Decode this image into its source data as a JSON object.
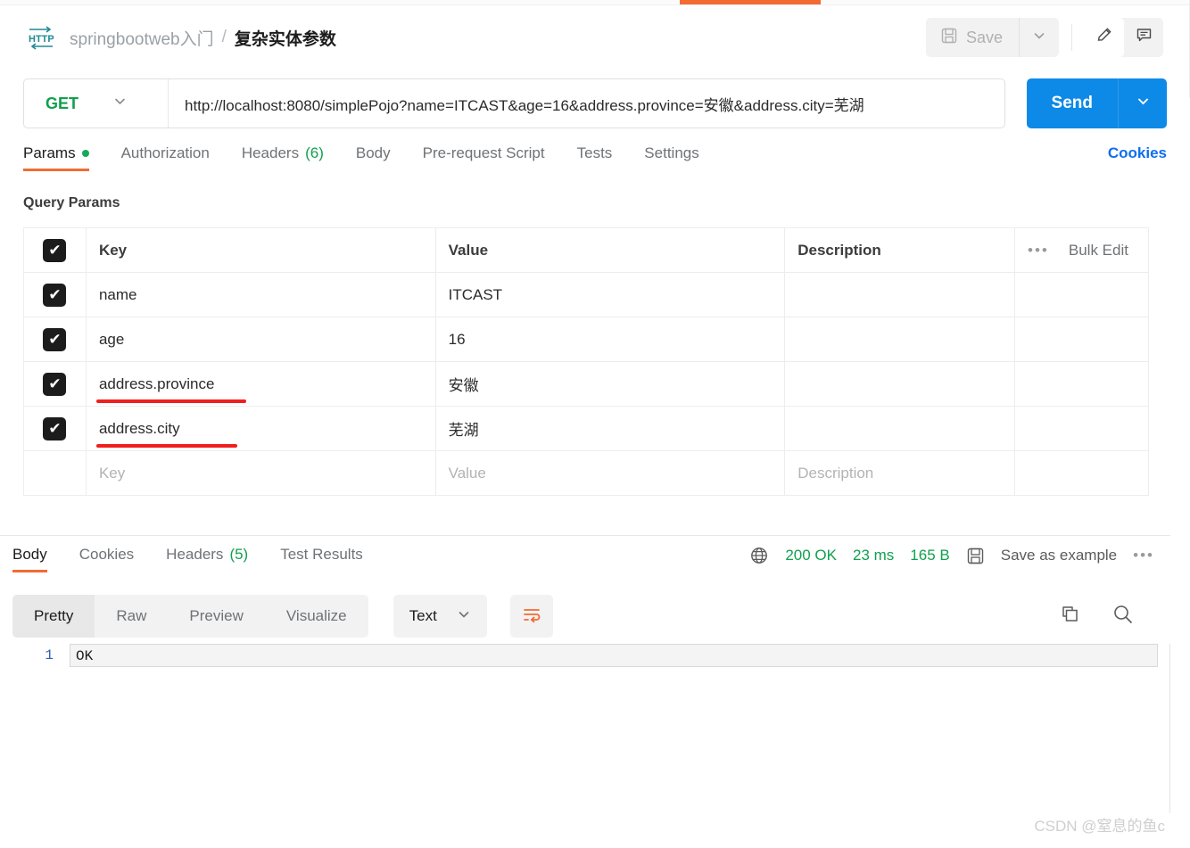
{
  "window": {
    "accent_orange": "#f26b33",
    "accent_blue": "#0d8ae8",
    "accent_green": "#11a04e"
  },
  "header": {
    "icon": "http-icon",
    "collection": "springbootweb入门",
    "separator": "/",
    "request_name": "复杂实体参数",
    "save_label": "Save",
    "save_icon": "floppy-disk-icon",
    "save_caret_icon": "chevron-down-icon",
    "edit_icon": "pencil-icon",
    "comment_icon": "comment-icon"
  },
  "url_bar": {
    "method": "GET",
    "method_caret_icon": "chevron-down-icon",
    "url": "http://localhost:8080/simplePojo?name=ITCAST&age=16&address.province=安徽&address.city=芜湖",
    "send_label": "Send",
    "send_caret_icon": "chevron-down-icon"
  },
  "request_tabs": {
    "items": [
      {
        "label": "Params",
        "active": true,
        "dot": true
      },
      {
        "label": "Authorization",
        "active": false
      },
      {
        "label": "Headers",
        "count": "(6)",
        "active": false
      },
      {
        "label": "Body",
        "active": false
      },
      {
        "label": "Pre-request Script",
        "active": false
      },
      {
        "label": "Tests",
        "active": false
      },
      {
        "label": "Settings",
        "active": false
      }
    ],
    "cookies_label": "Cookies"
  },
  "query_params": {
    "title": "Query Params",
    "columns": {
      "key": "Key",
      "value": "Value",
      "description": "Description",
      "bulk_edit": "Bulk Edit",
      "more_icon": "ellipsis-icon"
    },
    "rows": [
      {
        "checked": true,
        "key": "name",
        "value": "ITCAST",
        "description": "",
        "annotated": false
      },
      {
        "checked": true,
        "key": "age",
        "value": "16",
        "description": "",
        "annotated": false
      },
      {
        "checked": true,
        "key": "address.province",
        "value": "安徽",
        "description": "",
        "annotated": true
      },
      {
        "checked": true,
        "key": "address.city",
        "value": "芜湖",
        "description": "",
        "annotated": true
      }
    ],
    "placeholder_row": {
      "key": "Key",
      "value": "Value",
      "description": "Description"
    },
    "checkmark": "✔"
  },
  "response": {
    "tabs": [
      {
        "label": "Body",
        "active": true
      },
      {
        "label": "Cookies",
        "active": false
      },
      {
        "label": "Headers",
        "count": "(5)",
        "active": false
      },
      {
        "label": "Test Results",
        "active": false
      }
    ],
    "globe_icon": "globe-icon",
    "status": "200 OK",
    "time": "23 ms",
    "size": "165 B",
    "save_example_icon": "floppy-disk-icon",
    "save_example_label": "Save as example",
    "more_icon": "ellipsis-icon"
  },
  "viewer": {
    "modes": [
      {
        "label": "Pretty",
        "active": true
      },
      {
        "label": "Raw",
        "active": false
      },
      {
        "label": "Preview",
        "active": false
      },
      {
        "label": "Visualize",
        "active": false
      }
    ],
    "content_type": "Text",
    "content_type_caret_icon": "chevron-down-icon",
    "wrap_icon": "wrap-text-icon",
    "copy_icon": "copy-icon",
    "search_icon": "search-icon"
  },
  "body": {
    "lines": [
      {
        "number": "1",
        "text": "OK"
      }
    ]
  },
  "watermark": "CSDN @窒息的鱼c"
}
